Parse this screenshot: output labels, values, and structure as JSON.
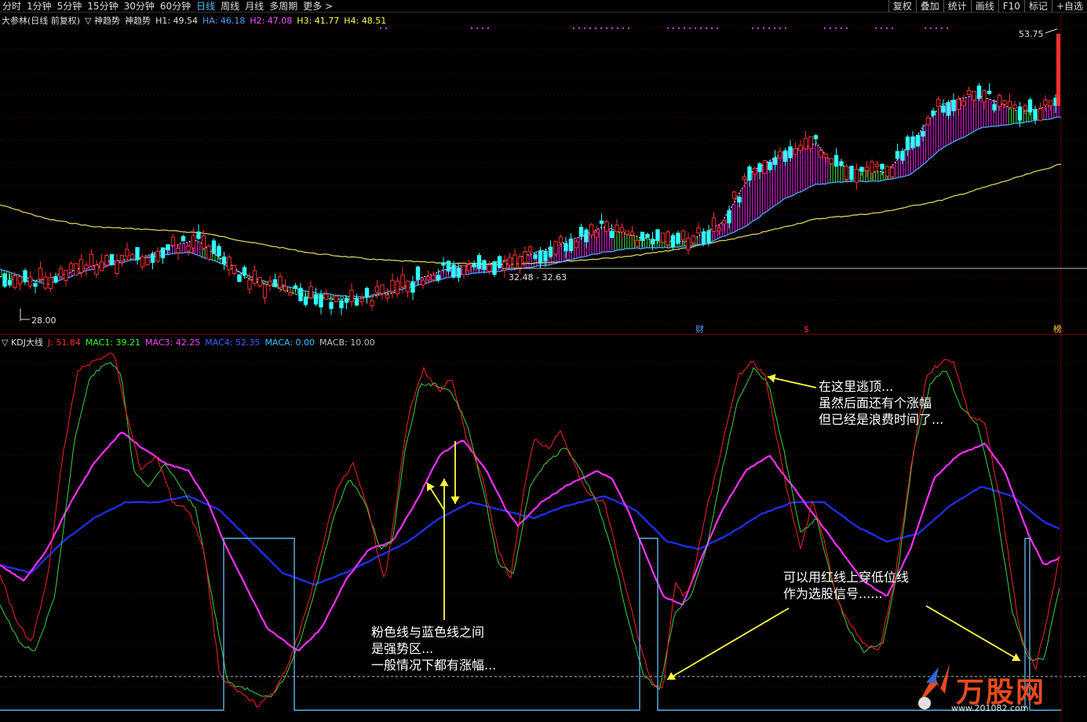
{
  "periods": [
    "分时",
    "1分钟",
    "5分钟",
    "15分钟",
    "30分钟",
    "60分钟",
    "日线",
    "周线",
    "月线",
    "多周期",
    "更多 >"
  ],
  "active_period": "日线",
  "tools": [
    "复权",
    "叠加",
    "统计",
    "画线",
    "F10",
    "标记",
    "+自选"
  ],
  "price_panel": {
    "title": "大参林(日线 前复权)",
    "indicator_name": "▽ 神趋势",
    "indicator_label": "神趋势",
    "values": [
      {
        "label": "H1: 49.54",
        "color": "#e0e0e0"
      },
      {
        "label": "HA: 46.18",
        "color": "#4ea0ff"
      },
      {
        "label": "H2: 47.08",
        "color": "#ff4fff"
      },
      {
        "label": "H3: 41.77",
        "color": "#ffff50"
      },
      {
        "label": "H4: 48.51",
        "color": "#ffff50"
      }
    ],
    "high_label": "53.75",
    "low_label": "28.00",
    "range_label": "32.48 - 32.63",
    "markers": [
      "财",
      "$",
      "榜"
    ]
  },
  "kdj_panel": {
    "title": "▽ KDJ大线",
    "values": [
      {
        "label": "J: 51.84",
        "color": "#ff3030"
      },
      {
        "label": "MAC1: 39.21",
        "color": "#30ff30"
      },
      {
        "label": "MAC3: 42.25",
        "color": "#ff40ff"
      },
      {
        "label": "MAC4: 52.35",
        "color": "#4060ff"
      },
      {
        "label": "MACA: 0.00",
        "color": "#40c0ff"
      },
      {
        "label": "MACB: 10.00",
        "color": "#c0c0c0"
      }
    ]
  },
  "annotations": {
    "top_escape": [
      "在这里逃顶...",
      "虽然后面还有个涨幅",
      "但已经是浪费时间了..."
    ],
    "strong_zone": [
      "粉色线与蓝色线之间",
      "是强势区...",
      "一般情况下都有涨幅..."
    ],
    "signal": [
      "可以用红线上穿低位线",
      "作为选股信号......"
    ]
  },
  "watermark": {
    "text": "万股网",
    "url": "www.201082.com"
  },
  "colors": {
    "up": "#ff3030",
    "down": "#30ffff",
    "pink": "#ff40ff",
    "green": "#40d040"
  }
}
